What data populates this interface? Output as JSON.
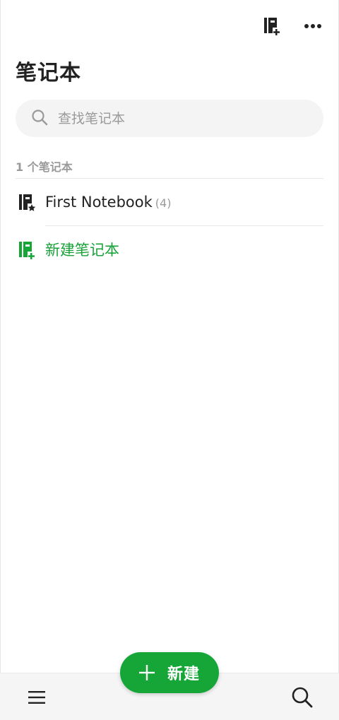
{
  "header": {
    "title": "笔记本",
    "icons": [
      "new-notebook-icon",
      "more-icon"
    ]
  },
  "search": {
    "placeholder": "查找笔记本",
    "value": ""
  },
  "list": {
    "count_label": "1 个笔记本",
    "notebooks": [
      {
        "name": "First Notebook",
        "count": "(4)",
        "icon": "notebook-star-icon"
      }
    ],
    "create_label": "新建笔记本"
  },
  "fab": {
    "label": "新建"
  },
  "bottom_bar": {
    "icons": [
      "menu-icon",
      "search-icon"
    ]
  },
  "colors": {
    "accent": "#15a637",
    "muted": "#9a9a9a",
    "text": "#222222"
  }
}
